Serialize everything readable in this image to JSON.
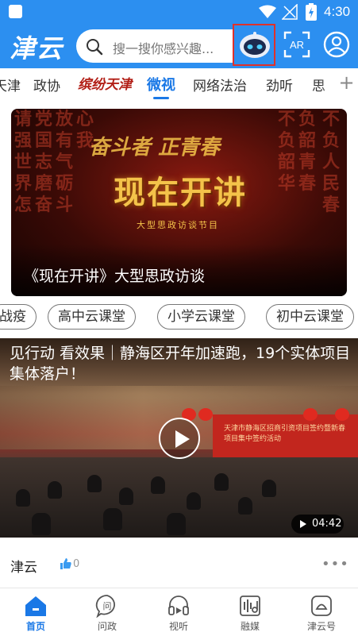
{
  "status_bar": {
    "time": "4:30"
  },
  "header": {
    "logo_text": "津云",
    "search_placeholder": "搜一搜你感兴趣...",
    "ar_label": "AR"
  },
  "tabs": [
    {
      "label": "天津"
    },
    {
      "label": "政协"
    },
    {
      "label": "缤纷天津"
    },
    {
      "label": "微视",
      "active": true
    },
    {
      "label": "网络法治"
    },
    {
      "label": "劲听"
    },
    {
      "label": "思"
    }
  ],
  "tab_add": "+",
  "banner": {
    "top_script": "奋斗者 正青春",
    "hero_text": "现在开讲",
    "sub_text": "大型思政访谈节目",
    "caption": "《现在开讲》大型思政访谈",
    "slide_count": 4,
    "active_slide": 0
  },
  "chips": [
    {
      "label": "战疫"
    },
    {
      "label": "高中云课堂"
    },
    {
      "label": "小学云课堂"
    },
    {
      "label": "初中云课堂"
    }
  ],
  "video": {
    "title": "见行动 看效果｜静海区开年加速跑，19个实体项目集体落户！",
    "stage_text": "天津市静海区招商引资项目签约暨新春项目集中签约活动",
    "duration": "04:42"
  },
  "card_footer": {
    "source": "津云",
    "likes": "0",
    "more": "•••"
  },
  "bottom_nav": [
    {
      "label": "首页",
      "icon": "home-icon",
      "active": true
    },
    {
      "label": "问政",
      "icon": "ask-icon"
    },
    {
      "label": "视听",
      "icon": "headphones-icon"
    },
    {
      "label": "融媒",
      "icon": "media-icon"
    },
    {
      "label": "津云号",
      "icon": "account-icon"
    }
  ],
  "colors": {
    "header_blue": "#2c8ff0",
    "accent_blue": "#1a78e6",
    "highlight_red": "#e0312a",
    "banner_gold": "#f4c34a"
  }
}
